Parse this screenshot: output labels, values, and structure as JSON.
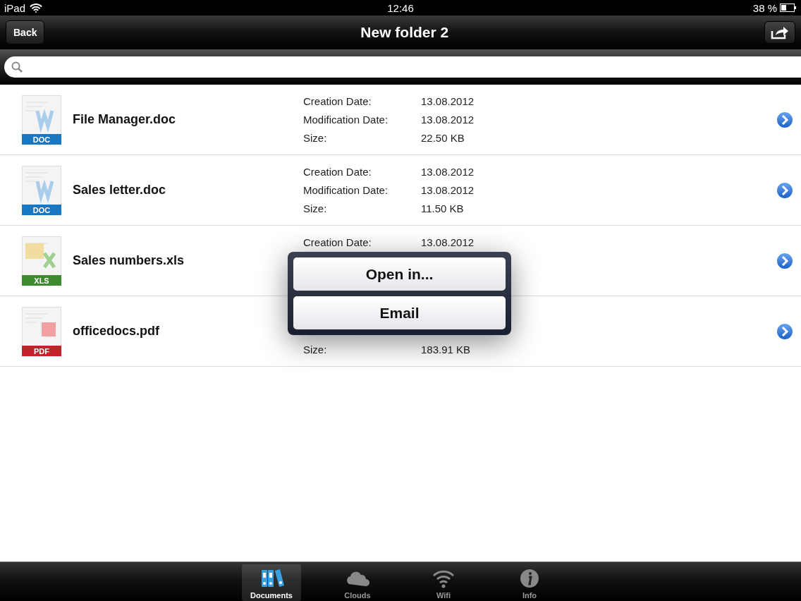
{
  "status_bar": {
    "device": "iPad",
    "time": "12:46",
    "battery": "38 %"
  },
  "nav_bar": {
    "back": "Back",
    "title": "New folder 2"
  },
  "files": [
    {
      "name": "File Manager.doc",
      "kind": "doc",
      "badge": "DOC",
      "details": [
        {
          "kind": "creation",
          "label": "Creation Date:",
          "value": "13.08.2012"
        },
        {
          "kind": "modification",
          "label": "Modification Date:",
          "value": "13.08.2012"
        },
        {
          "kind": "size",
          "label": "Size:",
          "value": "22.50 KB"
        }
      ]
    },
    {
      "name": "Sales letter.doc",
      "kind": "doc",
      "badge": "DOC",
      "details": [
        {
          "kind": "creation",
          "label": "Creation Date:",
          "value": "13.08.2012"
        },
        {
          "kind": "modification",
          "label": "Modification Date:",
          "value": "13.08.2012"
        },
        {
          "kind": "size",
          "label": "Size:",
          "value": "11.50 KB"
        }
      ]
    },
    {
      "name": "Sales numbers.xls",
      "kind": "xls",
      "badge": "XLS",
      "details": [
        {
          "kind": "creation",
          "label": "Creation Date:",
          "value": "13.08.2012"
        }
      ]
    },
    {
      "name": "officedocs.pdf",
      "kind": "pdf",
      "badge": "PDF",
      "details": [
        {
          "kind": "size",
          "label": "Size:",
          "value": "183.91 KB"
        }
      ]
    }
  ],
  "popover": {
    "buttons": [
      "Open in...",
      "Email"
    ]
  },
  "tab_bar": [
    {
      "label": "Documents",
      "kind": "binders",
      "selected": true
    },
    {
      "label": "Clouds",
      "kind": "cloud",
      "selected": false
    },
    {
      "label": "Wifi",
      "kind": "wifi",
      "selected": false
    },
    {
      "label": "Info",
      "kind": "info",
      "selected": false
    }
  ]
}
